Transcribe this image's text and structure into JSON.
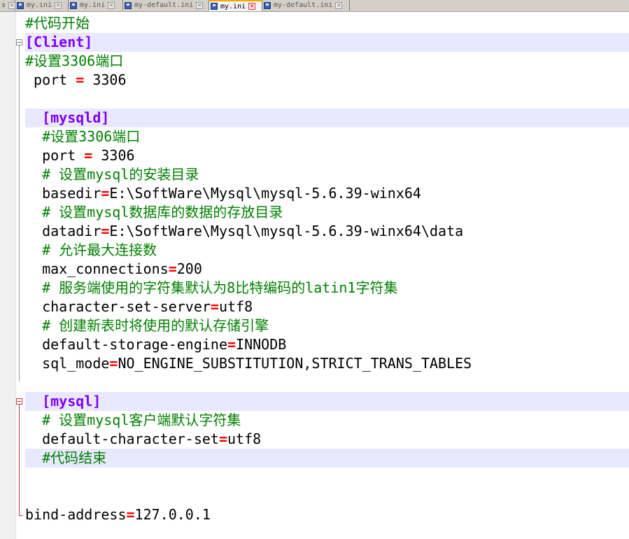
{
  "tabs": [
    {
      "label": "s"
    },
    {
      "label": "my.ini"
    },
    {
      "label": "my.ini"
    },
    {
      "label": "my-default.ini"
    },
    {
      "label": "my.ini",
      "active": true
    },
    {
      "label": "my-default.ini"
    }
  ],
  "close_glyph": "×",
  "colors": {
    "comment": "#008000",
    "section": "#8000ff",
    "operator": "#ff0000",
    "highlight": "#e8e8ff"
  },
  "lines": {
    "l1": {
      "text": "#代码开始"
    },
    "l2": {
      "text": "[Client]"
    },
    "l3": {
      "text": "#设置3306端口"
    },
    "l4": {
      "key": " port ",
      "op": "=",
      "val": " 3306"
    },
    "l6": {
      "text": "  [mysqld]"
    },
    "l7": {
      "text": "  #设置3306端口"
    },
    "l8": {
      "key": "  port ",
      "op": "=",
      "val": " 3306"
    },
    "l9": {
      "text": "  # 设置mysql的安装目录"
    },
    "l10": {
      "key": "  basedir",
      "op": "=",
      "val": "E:\\SoftWare\\Mysql\\mysql-5.6.39-winx64"
    },
    "l11": {
      "text": "  # 设置mysql数据库的数据的存放目录"
    },
    "l12": {
      "key": "  datadir",
      "op": "=",
      "val": "E:\\SoftWare\\Mysql\\mysql-5.6.39-winx64\\data"
    },
    "l13": {
      "text": "  # 允许最大连接数"
    },
    "l14": {
      "key": "  max_connections",
      "op": "=",
      "val": "200"
    },
    "l15": {
      "text": "  # 服务端使用的字符集默认为8比特编码的latin1字符集"
    },
    "l16": {
      "key": "  character-set-server",
      "op": "=",
      "val": "utf8"
    },
    "l17": {
      "text": "  # 创建新表时将使用的默认存储引擎"
    },
    "l18": {
      "key": "  default-storage-engine",
      "op": "=",
      "val": "INNODB"
    },
    "l19": {
      "key": "  sql_mode",
      "op": "=",
      "val": "NO_ENGINE_SUBSTITUTION,STRICT_TRANS_TABLES"
    },
    "l21": {
      "text": "  [mysql]"
    },
    "l22": {
      "text": "  # 设置mysql客户端默认字符集"
    },
    "l23": {
      "key": "  default-character-set",
      "op": "=",
      "val": "utf8"
    },
    "l24": {
      "text": "  #代码结束"
    },
    "l27": {
      "key": "bind-address",
      "op": "=",
      "val": "127.0.0.1"
    }
  }
}
